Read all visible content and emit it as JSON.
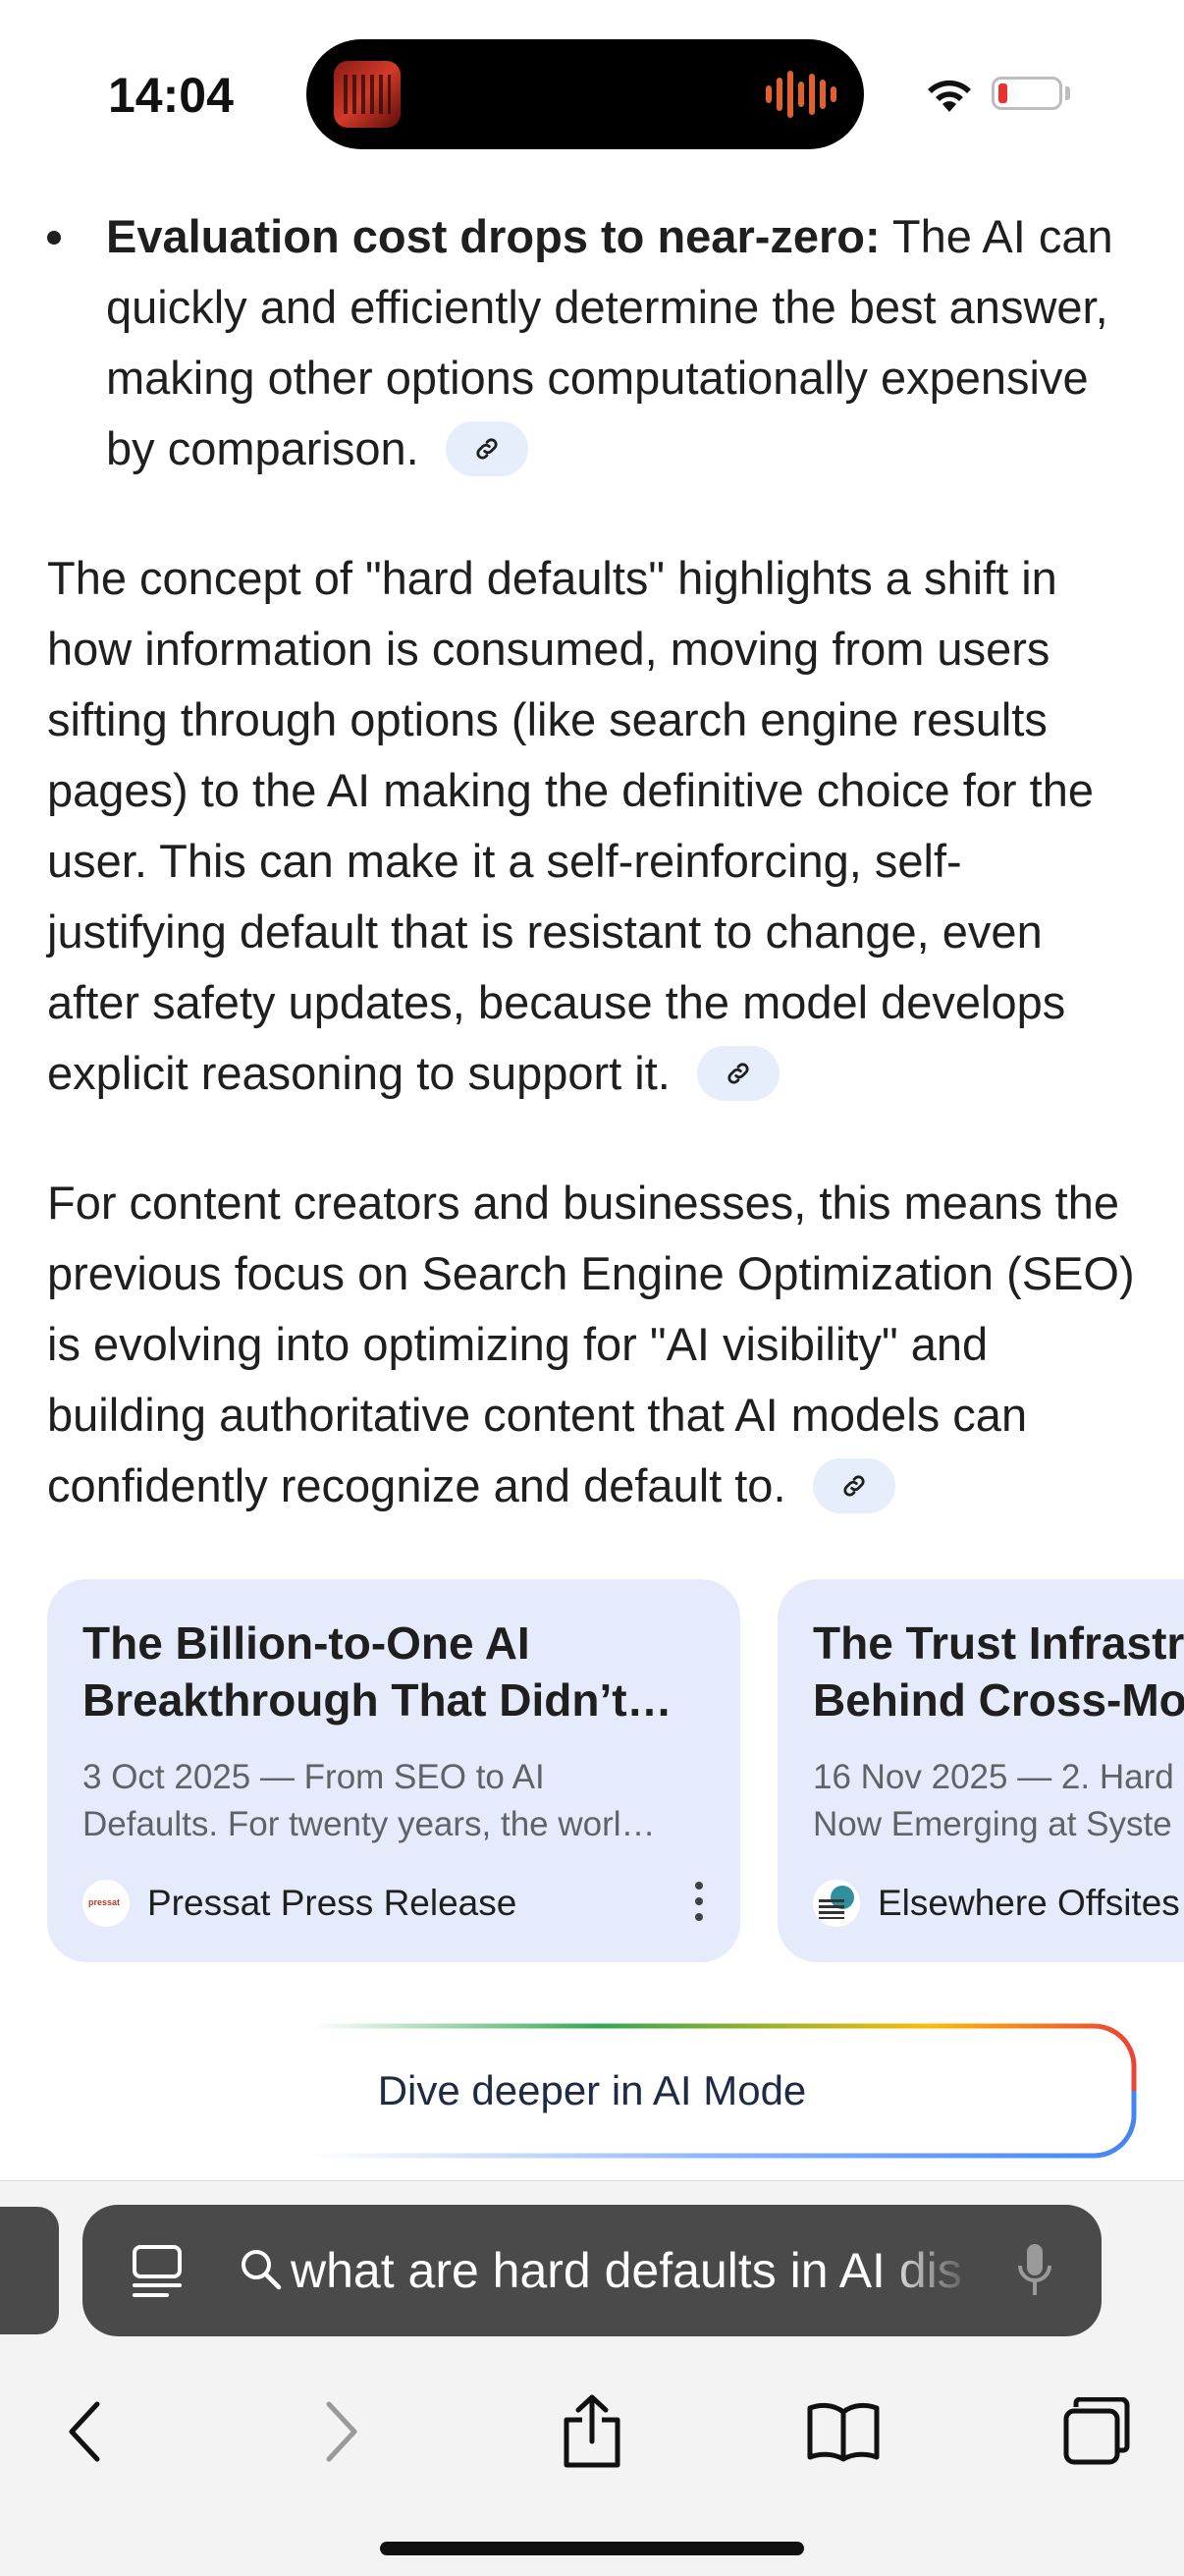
{
  "status_bar": {
    "time": "14:04"
  },
  "article": {
    "bullet": {
      "bold": "Evaluation cost drops to near-zero:",
      "text": " The AI can quickly and efficiently determine the best answer, making other options computationally expensive by comparison."
    },
    "paragraphs": [
      "The concept of \"hard defaults\" highlights a shift in how information is consumed, moving from users sifting through options (like search engine results pages) to the AI making the definitive choice for the user. This can make it a self-reinforcing, self-justifying default that is resistant to change, even after safety updates, because the model develops explicit reasoning to support it.",
      "For content creators and businesses, this means the previous focus on Search Engine Optimization (SEO) is evolving into optimizing for \"AI visibility\" and building authoritative content that AI models can confidently recognize and default to."
    ]
  },
  "cards": [
    {
      "title_line1": "The Billion-to-One AI",
      "title_line2": "Breakthrough That Didn’t…",
      "snippet_line1": "3 Oct 2025 — From SEO to AI",
      "snippet_line2": "Defaults. For twenty years, the worl…",
      "source": "Pressat Press Release",
      "favicon_text": "pressat"
    },
    {
      "title_line1": "The Trust Infrastr",
      "title_line2": "Behind Cross-Mo",
      "snippet_line1": "16 Nov 2025 — 2. Hard",
      "snippet_line2": "Now Emerging at Syste",
      "source": "Elsewhere Offsites"
    }
  ],
  "dive_button": {
    "label": "Dive deeper in AI Mode"
  },
  "browser": {
    "address_text": "what are hard defaults in AI dis"
  },
  "icons": {
    "cite": "link-icon",
    "reader": "reader-icon",
    "search": "search-icon",
    "mic": "microphone-icon",
    "back": "chevron-left-icon",
    "forward": "chevron-right-icon",
    "share": "share-icon",
    "bookmarks": "book-icon",
    "tabs": "tabs-icon"
  },
  "colors": {
    "card_bg": "#e5ebfb",
    "cite_bg": "#e6edfb",
    "chrome_bg": "#f3f3f3",
    "address_bg": "#4a4a4a",
    "battery_low": "#e8322e"
  }
}
